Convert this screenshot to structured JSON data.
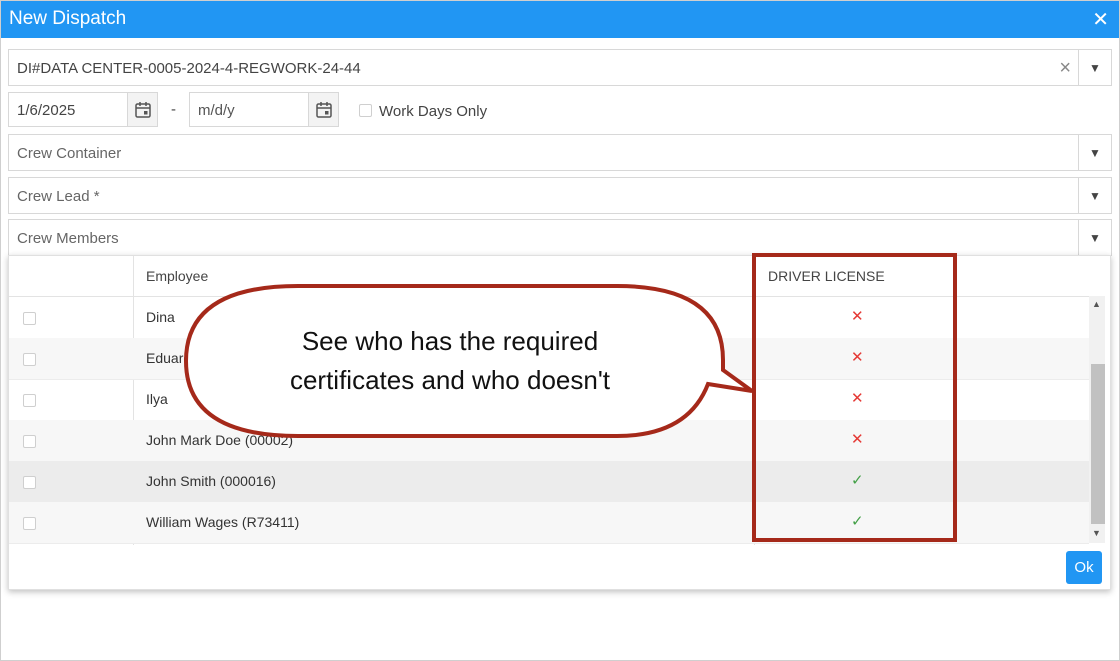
{
  "window": {
    "title": "New Dispatch"
  },
  "dispatch": {
    "value": "DI#DATA CENTER-0005-2024-4-REGWORK-24-44"
  },
  "dates": {
    "start": "1/6/2025",
    "end_placeholder": "m/d/y",
    "work_days_label": "Work Days Only"
  },
  "crew_container": {
    "placeholder": "Crew Container"
  },
  "crew_lead": {
    "placeholder": "Crew Lead *"
  },
  "crew_members": {
    "placeholder": "Crew Members"
  },
  "table": {
    "columns": [
      "Employee",
      "DRIVER LICENSE"
    ],
    "rows": [
      {
        "name": "Dina",
        "license": "✕",
        "has_license": false
      },
      {
        "name": "Eduardo",
        "license": "✕",
        "has_license": false
      },
      {
        "name": "Ilya",
        "license": "✕",
        "has_license": false
      },
      {
        "name": "John Mark Doe (00002)",
        "license": "✕",
        "has_license": false
      },
      {
        "name": "John Smith (000016)",
        "license": "✓",
        "has_license": true
      },
      {
        "name": "William Wages (R73411)",
        "license": "✓",
        "has_license": true
      }
    ]
  },
  "ok_label": "Ok",
  "callout": {
    "line1": "See who has the required",
    "line2": "certificates and who doesn't"
  },
  "colors": {
    "accent": "#2196f3",
    "highlight": "#a5291a",
    "no": "#e53935",
    "yes": "#43a047"
  }
}
